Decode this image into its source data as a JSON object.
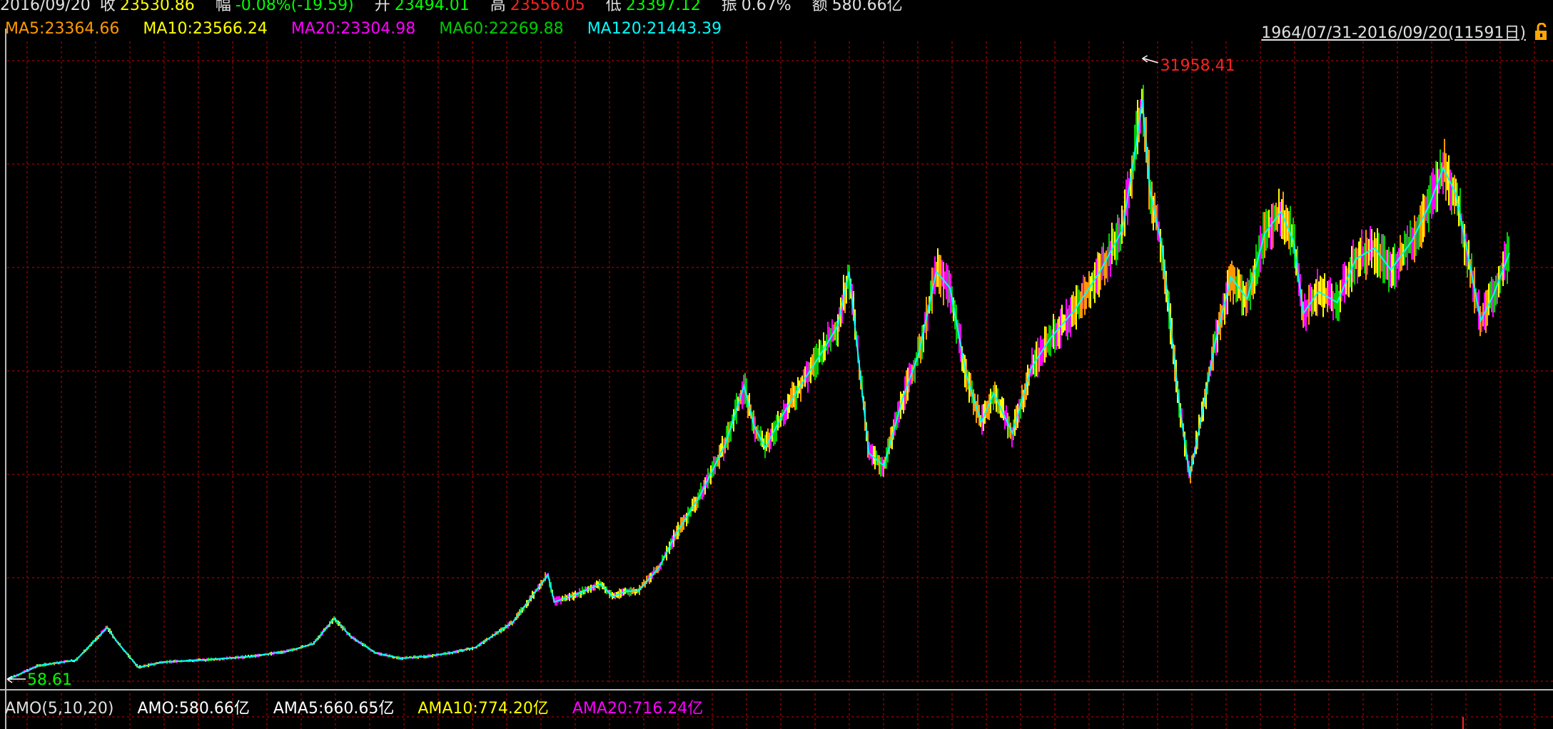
{
  "header": {
    "date": "2016/09/20",
    "close_label": "收",
    "close_value": "23530.86",
    "change_label": "幅",
    "change_value": "-0.08%(-19.59)",
    "open_label": "开",
    "open_value": "23494.01",
    "high_label": "高",
    "high_value": "23556.05",
    "low_label": "低",
    "low_value": "23397.12",
    "amp_label": "振",
    "amp_value": "0.67%",
    "amount_label": "额",
    "amount_value": "580.66亿"
  },
  "ma_legend": [
    {
      "text": "MA5:23364.66",
      "color": "#ff9900"
    },
    {
      "text": "MA10:23566.24",
      "color": "#ffff00"
    },
    {
      "text": "MA20:23304.98",
      "color": "#ff00ff"
    },
    {
      "text": "MA60:22269.88",
      "color": "#00cc00"
    },
    {
      "text": "MA120:21443.39",
      "color": "#00ffff"
    }
  ],
  "range_label": "1964/07/31-2016/09/20(11591日)",
  "amo_legend": [
    {
      "text": "AMO(5,10,20)",
      "color": "#e0e0e0"
    },
    {
      "text": "AMO:580.66亿",
      "color": "#ffffff"
    },
    {
      "text": "AMA5:660.65亿",
      "color": "#ffffff"
    },
    {
      "text": "AMA10:774.20亿",
      "color": "#ffff00"
    },
    {
      "text": "AMA20:716.24亿",
      "color": "#ff00ff"
    }
  ],
  "colors": {
    "grid": "#8b0000",
    "max_label": "#ff2020",
    "min_label": "#00ff00",
    "ma_line": "#00ffff",
    "price_series": [
      "#ff00ff",
      "#ffff00",
      "#ff9900",
      "#00cc00"
    ]
  },
  "chart_data": {
    "type": "line",
    "title": "",
    "xlabel": "",
    "ylabel": "",
    "x_range": [
      "1964/07/31",
      "2016/09/20"
    ],
    "ylim": [
      0,
      33000
    ],
    "max_marker": "31958.41",
    "min_marker": "58.61",
    "series": [
      {
        "values": [
          {
            "x": 1964.6,
            "y": 59
          },
          {
            "x": 1967,
            "y": 800
          },
          {
            "x": 1970,
            "y": 1100
          },
          {
            "x": 1972.5,
            "y": 2900
          },
          {
            "x": 1973.3,
            "y": 2100
          },
          {
            "x": 1975,
            "y": 700
          },
          {
            "x": 1977,
            "y": 1000
          },
          {
            "x": 1980,
            "y": 1100
          },
          {
            "x": 1984,
            "y": 1300
          },
          {
            "x": 1987,
            "y": 1600
          },
          {
            "x": 1989,
            "y": 2000
          },
          {
            "x": 1990.7,
            "y": 3400
          },
          {
            "x": 1992,
            "y": 2400
          },
          {
            "x": 1994,
            "y": 1500
          },
          {
            "x": 1996,
            "y": 1200
          },
          {
            "x": 1998,
            "y": 1300
          },
          {
            "x": 2000,
            "y": 1500
          },
          {
            "x": 2002,
            "y": 1800
          },
          {
            "x": 2005,
            "y": 3200
          },
          {
            "x": 2007.8,
            "y": 5800
          },
          {
            "x": 2008.3,
            "y": 4300
          },
          {
            "x": 2010,
            "y": 4700
          },
          {
            "x": 2012,
            "y": 5300
          },
          {
            "x": 2013,
            "y": 4600
          },
          {
            "x": 2014,
            "y": 4900
          },
          {
            "x": 2015,
            "y": 4900
          },
          {
            "x": 2016.7,
            "y": 6200
          },
          {
            "x": 2018,
            "y": 8000
          },
          {
            "x": 2020,
            "y": 10200
          },
          {
            "x": 2022,
            "y": 13000
          },
          {
            "x": 2023.5,
            "y": 16200
          },
          {
            "x": 2024.3,
            "y": 14000
          },
          {
            "x": 2025.2,
            "y": 12800
          },
          {
            "x": 2026.5,
            "y": 14500
          },
          {
            "x": 2028,
            "y": 16200
          },
          {
            "x": 2029.5,
            "y": 17800
          },
          {
            "x": 2031,
            "y": 19500
          },
          {
            "x": 2031.9,
            "y": 22500
          },
          {
            "x": 2032.7,
            "y": 17500
          },
          {
            "x": 2033.5,
            "y": 12500
          },
          {
            "x": 2034.7,
            "y": 11800
          },
          {
            "x": 2036.2,
            "y": 15500
          },
          {
            "x": 2037.5,
            "y": 18000
          },
          {
            "x": 2038.9,
            "y": 22500
          },
          {
            "x": 2040,
            "y": 21600
          },
          {
            "x": 2041.3,
            "y": 16800
          },
          {
            "x": 2042.5,
            "y": 14200
          },
          {
            "x": 2043.5,
            "y": 15800
          },
          {
            "x": 2045,
            "y": 13600
          },
          {
            "x": 2046.5,
            "y": 17200
          },
          {
            "x": 2048,
            "y": 18800
          },
          {
            "x": 2050,
            "y": 20400
          },
          {
            "x": 2052,
            "y": 22500
          },
          {
            "x": 2053.8,
            "y": 24800
          },
          {
            "x": 2054.9,
            "y": 29500
          },
          {
            "x": 2055.4,
            "y": 31958
          },
          {
            "x": 2056,
            "y": 27000
          },
          {
            "x": 2057,
            "y": 23800
          },
          {
            "x": 2058.3,
            "y": 15500
          },
          {
            "x": 2059.2,
            "y": 11200
          },
          {
            "x": 2060,
            "y": 14000
          },
          {
            "x": 2061.2,
            "y": 18500
          },
          {
            "x": 2062.5,
            "y": 22200
          },
          {
            "x": 2063.8,
            "y": 21000
          },
          {
            "x": 2065.2,
            "y": 24600
          },
          {
            "x": 2066.5,
            "y": 25800
          },
          {
            "x": 2067.5,
            "y": 24200
          },
          {
            "x": 2068.3,
            "y": 20200
          },
          {
            "x": 2069.5,
            "y": 21400
          },
          {
            "x": 2071,
            "y": 20800
          },
          {
            "x": 2072.5,
            "y": 23200
          },
          {
            "x": 2074,
            "y": 23800
          },
          {
            "x": 2075.3,
            "y": 22600
          },
          {
            "x": 2077,
            "y": 24200
          },
          {
            "x": 2078.4,
            "y": 26200
          },
          {
            "x": 2079.5,
            "y": 28200
          },
          {
            "x": 2080.5,
            "y": 26800
          },
          {
            "x": 2081.5,
            "y": 23300
          },
          {
            "x": 2082.5,
            "y": 19800
          },
          {
            "x": 2083.5,
            "y": 21200
          },
          {
            "x": 2084.8,
            "y": 23531
          }
        ]
      }
    ]
  }
}
